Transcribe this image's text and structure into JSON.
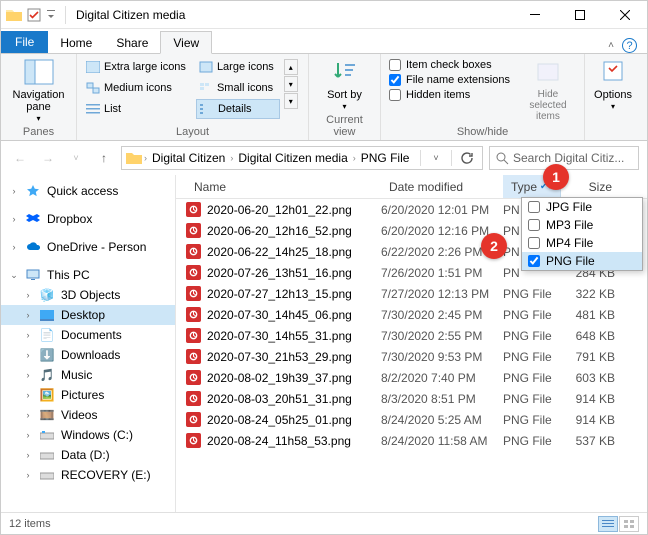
{
  "window": {
    "title": "Digital Citizen media"
  },
  "tabs": {
    "file": "File",
    "home": "Home",
    "share": "Share",
    "view": "View"
  },
  "ribbon": {
    "panes": {
      "label": "Panes",
      "nav_pane": "Navigation pane"
    },
    "layout": {
      "label": "Layout",
      "xl": "Extra large icons",
      "lg": "Large icons",
      "md": "Medium icons",
      "sm": "Small icons",
      "list": "List",
      "details": "Details"
    },
    "current_view": {
      "label": "Current view",
      "sort": "Sort by"
    },
    "showhide": {
      "label": "Show/hide",
      "item_check": "Item check boxes",
      "file_ext": "File name extensions",
      "hidden": "Hidden items",
      "hide_sel": "Hide selected items"
    },
    "options": "Options"
  },
  "breadcrumbs": [
    "Digital Citizen",
    "Digital Citizen media",
    "PNG File"
  ],
  "search_placeholder": "Search Digital Citiz...",
  "nav": {
    "quick": "Quick access",
    "dropbox": "Dropbox",
    "onedrive": "OneDrive - Person",
    "pc": "This PC",
    "objects3d": "3D Objects",
    "desktop": "Desktop",
    "documents": "Documents",
    "downloads": "Downloads",
    "music": "Music",
    "pictures": "Pictures",
    "videos": "Videos",
    "winc": "Windows (C:)",
    "datad": "Data (D:)",
    "recovery": "RECOVERY (E:)"
  },
  "columns": {
    "name": "Name",
    "date": "Date modified",
    "type": "Type",
    "size": "Size"
  },
  "files": [
    {
      "name": "2020-06-20_12h01_22.png",
      "date": "6/20/2020 12:01 PM",
      "type": "PN",
      "size": ""
    },
    {
      "name": "2020-06-20_12h16_52.png",
      "date": "6/20/2020 12:16 PM",
      "type": "PN",
      "size": ""
    },
    {
      "name": "2020-06-22_14h25_18.png",
      "date": "6/22/2020 2:26 PM",
      "type": "PN",
      "size": ""
    },
    {
      "name": "2020-07-26_13h51_16.png",
      "date": "7/26/2020 1:51 PM",
      "type": "PN",
      "size": "284 KB"
    },
    {
      "name": "2020-07-27_12h13_15.png",
      "date": "7/27/2020 12:13 PM",
      "type": "PNG File",
      "size": "322 KB"
    },
    {
      "name": "2020-07-30_14h45_06.png",
      "date": "7/30/2020 2:45 PM",
      "type": "PNG File",
      "size": "481 KB"
    },
    {
      "name": "2020-07-30_14h55_31.png",
      "date": "7/30/2020 2:55 PM",
      "type": "PNG File",
      "size": "648 KB"
    },
    {
      "name": "2020-07-30_21h53_29.png",
      "date": "7/30/2020 9:53 PM",
      "type": "PNG File",
      "size": "791 KB"
    },
    {
      "name": "2020-08-02_19h39_37.png",
      "date": "8/2/2020 7:40 PM",
      "type": "PNG File",
      "size": "603 KB"
    },
    {
      "name": "2020-08-03_20h51_31.png",
      "date": "8/3/2020 8:51 PM",
      "type": "PNG File",
      "size": "914 KB"
    },
    {
      "name": "2020-08-24_05h25_01.png",
      "date": "8/24/2020 5:25 AM",
      "type": "PNG File",
      "size": "914 KB"
    },
    {
      "name": "2020-08-24_11h58_53.png",
      "date": "8/24/2020 11:58 AM",
      "type": "PNG File",
      "size": "537 KB"
    }
  ],
  "type_filter": {
    "options": [
      {
        "label": "JPG File",
        "checked": false
      },
      {
        "label": "MP3 File",
        "checked": false
      },
      {
        "label": "MP4 File",
        "checked": false
      },
      {
        "label": "PNG File",
        "checked": true
      }
    ]
  },
  "status": {
    "count": "12 items"
  },
  "callouts": {
    "b1": "1",
    "b2": "2"
  }
}
